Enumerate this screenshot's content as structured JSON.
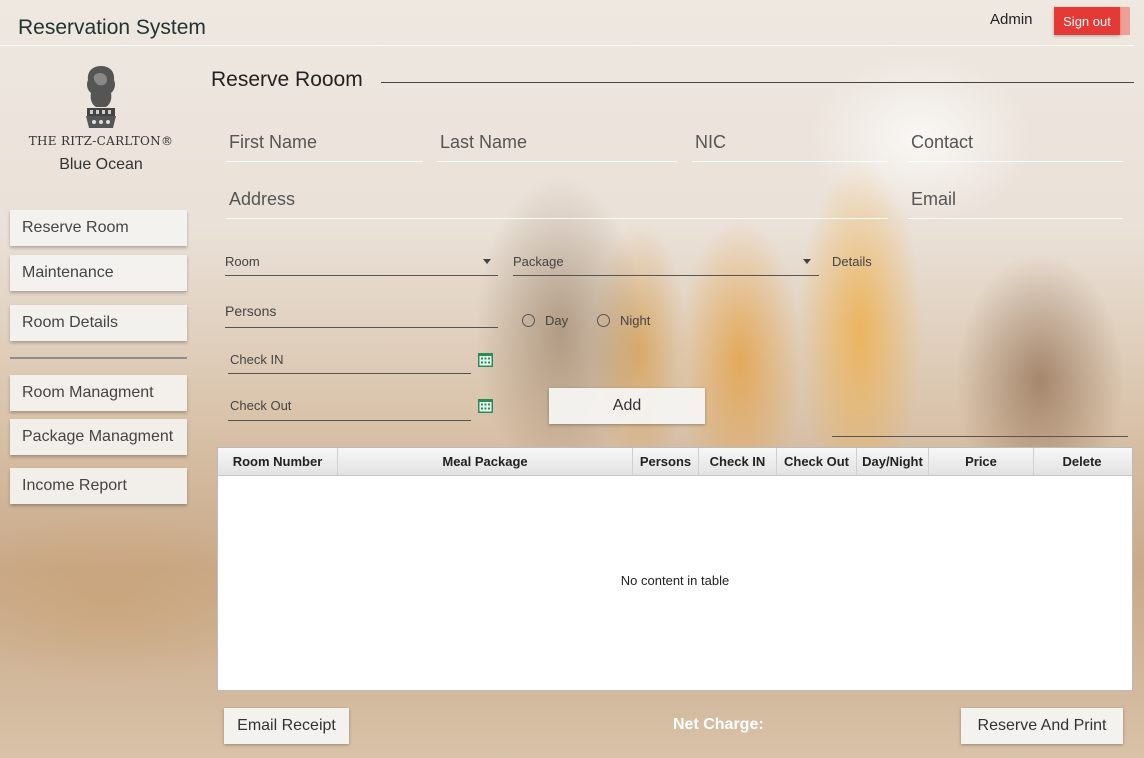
{
  "header": {
    "title": "Reservation System",
    "user": "Admin",
    "signout_label": "Sign out"
  },
  "brand": {
    "name": "THE RITZ-CARLTON®",
    "subtitle": "Blue Ocean"
  },
  "sidebar": {
    "items": [
      {
        "label": "Reserve Room"
      },
      {
        "label": "Maintenance"
      },
      {
        "label": "Room Details"
      },
      {
        "label": "Room Managment"
      },
      {
        "label": "Package Managment"
      },
      {
        "label": "Income Report"
      }
    ]
  },
  "form": {
    "section_title": "Reserve Rooom",
    "first_name": "First Name",
    "last_name": "Last Name",
    "nic": "NIC",
    "contact": "Contact",
    "address": "Address",
    "email": "Email",
    "room": "Room",
    "package": "Package",
    "details": "Details",
    "persons": "Persons",
    "day": "Day",
    "night": "Night",
    "check_in": "Check IN",
    "check_out": "Check Out",
    "add_label": "Add"
  },
  "table": {
    "columns": [
      "Room Number",
      "Meal Package",
      "Persons",
      "Check IN",
      "Check Out",
      "Day/Night",
      "Price",
      "Delete"
    ],
    "empty_message": "No content in table"
  },
  "footer": {
    "email_receipt": "Email Receipt",
    "net_charge": "Net Charge:",
    "reserve_print": "Reserve And Print"
  },
  "colors": {
    "signout": "#e53935",
    "calendar_icon": "#2e8b57"
  }
}
